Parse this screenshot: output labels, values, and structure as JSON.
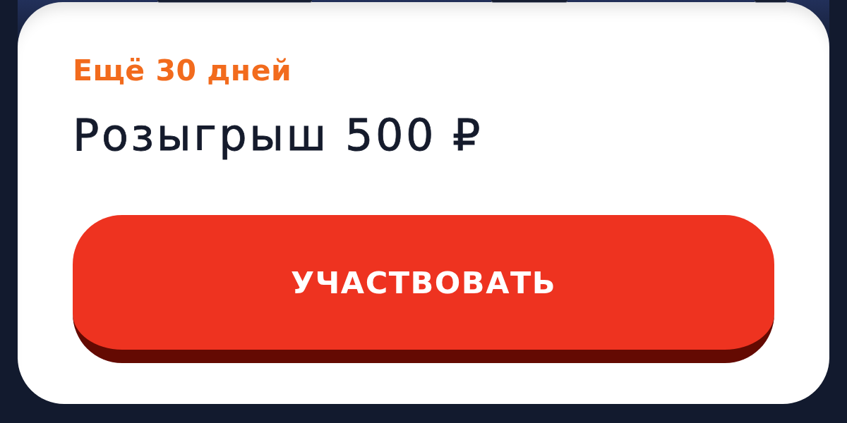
{
  "promo": {
    "countdown": "Ещё 30 дней",
    "title": "Розыгрыш 500 ₽",
    "button": {
      "label": "УЧАСТВОВАТЬ"
    }
  }
}
